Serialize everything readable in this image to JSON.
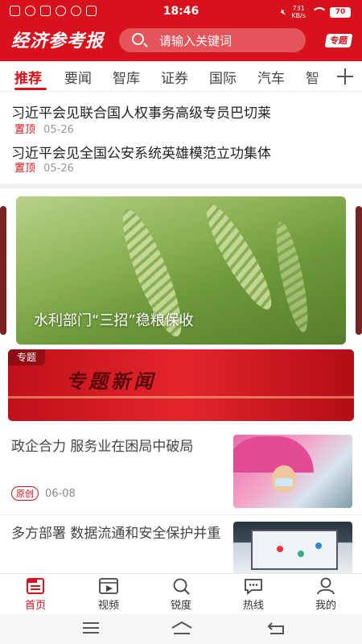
{
  "status_bar": {
    "time": "18:46",
    "net_speed_value": "731",
    "net_speed_unit": "KB/s",
    "battery": "70"
  },
  "header": {
    "logo": "经济参考报",
    "search_placeholder": "请输入关键词",
    "topic_button": "专题"
  },
  "tabs": [
    {
      "label": "推荐",
      "active": true
    },
    {
      "label": "要闻"
    },
    {
      "label": "智库"
    },
    {
      "label": "证券"
    },
    {
      "label": "国际"
    },
    {
      "label": "汽车"
    },
    {
      "label": "智"
    }
  ],
  "pinned_news": [
    {
      "title": "习近平会见联合国人权事务高级专员巴切莱",
      "tag": "置顶",
      "date": "05-26"
    },
    {
      "title": "习近平会见全国公安系统英雄模范立功集体",
      "tag": "置顶",
      "date": "05-26"
    }
  ],
  "banner": {
    "caption": "水利部门“三招”稳粮保收"
  },
  "special_topic": {
    "tag": "专题",
    "title": "专题新闻"
  },
  "news_list": [
    {
      "title": "政企合力 服务业在困局中破局",
      "badge": "原创",
      "date": "06-08"
    },
    {
      "title": "多方部署 数据流通和安全保护并重",
      "badge": "",
      "date": ""
    }
  ],
  "bottom_nav": [
    {
      "label": "首页",
      "icon": "news-icon",
      "active": true
    },
    {
      "label": "视频",
      "icon": "video-icon"
    },
    {
      "label": "锐度",
      "icon": "search-icon"
    },
    {
      "label": "热线",
      "icon": "chat-icon"
    },
    {
      "label": "我的",
      "icon": "user-icon"
    }
  ],
  "colors": {
    "brand_red": "#d8121c",
    "text_primary": "#222222",
    "text_secondary": "#999999"
  }
}
